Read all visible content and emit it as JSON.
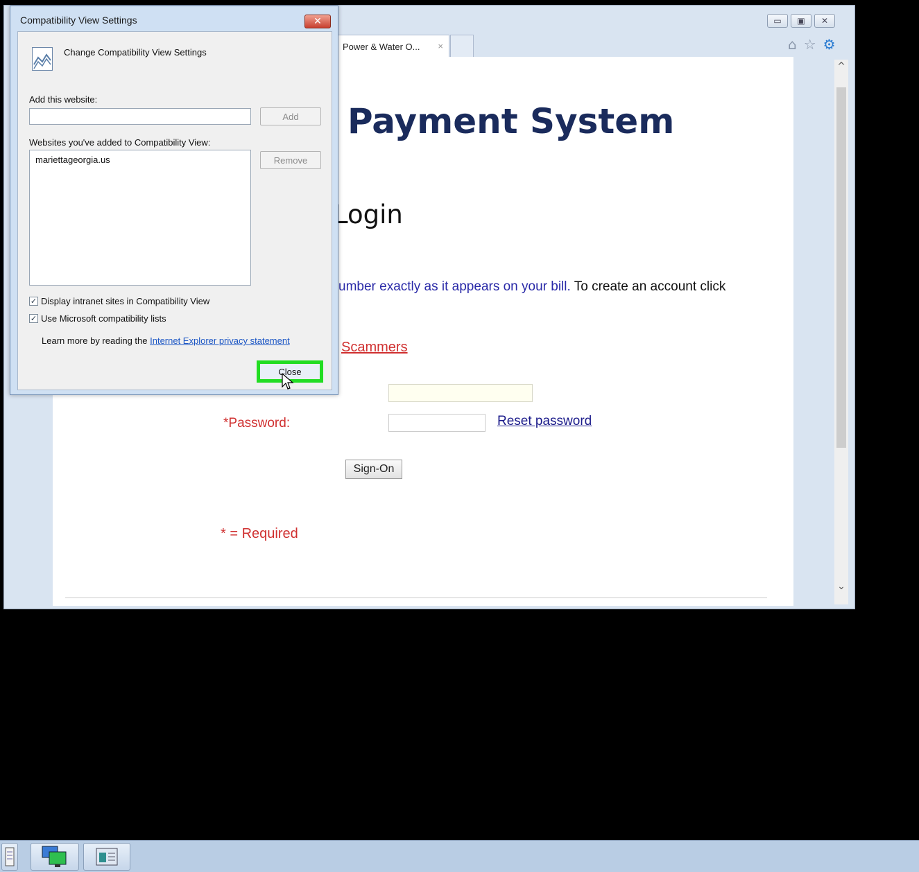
{
  "browser": {
    "tab_label": "Power & Water O...",
    "tab_close": "×",
    "window_controls": [
      "▭",
      "▣",
      "✕"
    ],
    "icons": {
      "home": "⌂",
      "favorites": "☆",
      "settings": "⚙"
    }
  },
  "page": {
    "title": "Payment System",
    "login_heading": "Login",
    "instruction_blue": "umber exactly as it appears on your bill.",
    "instruction_black": " To create an account click",
    "scammers_link": "Scammers",
    "password_label": "*Password:",
    "reset_link": "Reset password",
    "signon_label": "Sign-On",
    "required_note": "* = Required"
  },
  "dialog": {
    "title": "Compatibility View Settings",
    "close_x": "✕",
    "heading": "Change Compatibility View Settings",
    "add_label": "Add this website:",
    "add_value": "",
    "add_button": "Add",
    "list_label": "Websites you've added to Compatibility View:",
    "sites": [
      "mariettageorgia.us"
    ],
    "remove_button": "Remove",
    "check_intranet": {
      "label": "Display intranet sites in Compatibility View",
      "checked": true
    },
    "check_ms_lists": {
      "label": "Use Microsoft compatibility lists",
      "checked": true
    },
    "learn_text": "Learn more by reading the ",
    "privacy_link": "Internet Explorer privacy statement",
    "close_button": "Close"
  },
  "scroll": {
    "up": "^",
    "down": "⌄"
  },
  "checkmark": "✓"
}
